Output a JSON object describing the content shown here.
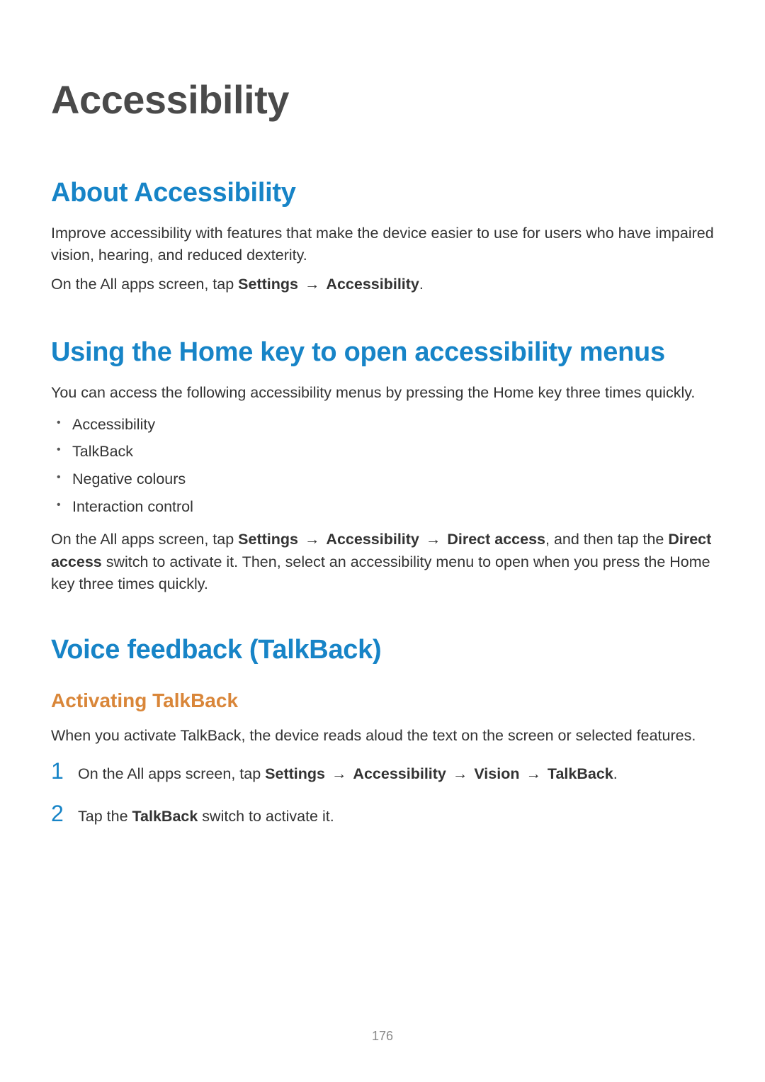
{
  "page_title": "Accessibility",
  "sections": {
    "about": {
      "heading": "About Accessibility",
      "p1": "Improve accessibility with features that make the device easier to use for users who have impaired vision, hearing, and reduced dexterity.",
      "p2_pre": "On the All apps screen, tap ",
      "p2_settings": "Settings",
      "p2_arrow": " → ",
      "p2_access": "Accessibility",
      "p2_post": "."
    },
    "homekey": {
      "heading": "Using the Home key to open accessibility menus",
      "p1": "You can access the following accessibility menus by pressing the Home key three times quickly.",
      "bullets": [
        "Accessibility",
        "TalkBack",
        "Negative colours",
        "Interaction control"
      ],
      "p2_pre": "On the All apps screen, tap ",
      "p2_settings": "Settings",
      "p2_arrow1": " → ",
      "p2_access": "Accessibility",
      "p2_arrow2": " → ",
      "p2_direct": "Direct access",
      "p2_mid": ", and then tap the ",
      "p2_direct2": "Direct access",
      "p2_post": " switch to activate it. Then, select an accessibility menu to open when you press the Home key three times quickly."
    },
    "voice": {
      "heading": "Voice feedback (TalkBack)",
      "sub_heading": "Activating TalkBack",
      "p1": "When you activate TalkBack, the device reads aloud the text on the screen or selected features.",
      "steps": {
        "s1": {
          "num": "1",
          "pre": "On the All apps screen, tap ",
          "settings": "Settings",
          "a1": " → ",
          "access": "Accessibility",
          "a2": " → ",
          "vision": "Vision",
          "a3": " → ",
          "talkback": "TalkBack",
          "post": "."
        },
        "s2": {
          "num": "2",
          "pre": "Tap the ",
          "talkback": "TalkBack",
          "post": " switch to activate it."
        }
      }
    }
  },
  "page_number": "176"
}
